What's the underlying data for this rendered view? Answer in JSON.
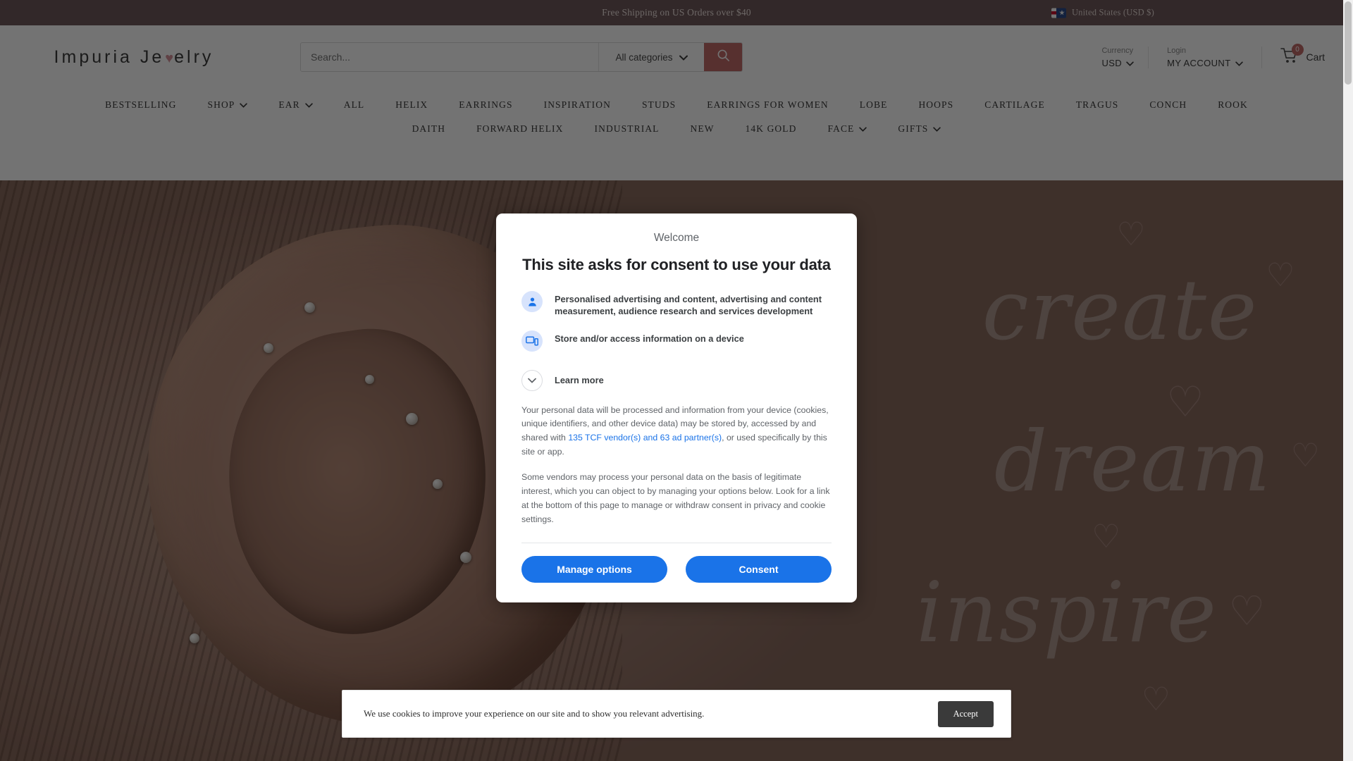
{
  "announcement": {
    "text": "Free Shipping on US Orders over $40",
    "language": "United States (USD $)",
    "flag_icon": "us-flag-icon"
  },
  "header": {
    "logo": {
      "part1": "Impuria Je",
      "heart": "♥",
      "part2": "elry"
    },
    "search": {
      "placeholder": "Search...",
      "value": "",
      "icon": "search-icon"
    },
    "categories": {
      "label": "All categories",
      "icon": "chevron-down-icon"
    },
    "currency": {
      "label": "Currency",
      "value": "USD",
      "icon": "chevron-down-icon"
    },
    "account": {
      "label": "Login",
      "value": "MY ACCOUNT",
      "icon": "chevron-down-icon"
    },
    "cart": {
      "label": "Cart",
      "count": "0",
      "icon": "cart-icon"
    }
  },
  "nav": {
    "row1": [
      {
        "label": "BESTSELLING",
        "caret": false
      },
      {
        "label": "SHOP",
        "caret": true
      },
      {
        "label": "EAR",
        "caret": true
      },
      {
        "label": "ALL",
        "caret": false
      },
      {
        "label": "HELIX",
        "caret": false
      },
      {
        "label": "EARRINGS",
        "caret": false
      },
      {
        "label": "INSPIRATION",
        "caret": false
      },
      {
        "label": "STUDS",
        "caret": false
      },
      {
        "label": "EARRINGS FOR WOMEN",
        "caret": false
      },
      {
        "label": "LOBE",
        "caret": false
      },
      {
        "label": "HOOPS",
        "caret": false
      },
      {
        "label": "CARTILAGE",
        "caret": false
      },
      {
        "label": "TRAGUS",
        "caret": false
      },
      {
        "label": "CONCH",
        "caret": false
      },
      {
        "label": "ROOK",
        "caret": false
      }
    ],
    "row2": [
      {
        "label": "DAITH",
        "caret": false
      },
      {
        "label": "FORWARD HELIX",
        "caret": false
      },
      {
        "label": "INDUSTRIAL",
        "caret": false
      },
      {
        "label": "NEW",
        "caret": false
      },
      {
        "label": "14K GOLD",
        "caret": false
      },
      {
        "label": "FACE",
        "caret": true
      },
      {
        "label": "GIFTS",
        "caret": true
      }
    ]
  },
  "hero": {
    "word1": "create",
    "word2": "dream",
    "word3": "inspire"
  },
  "consent_modal": {
    "welcome": "Welcome",
    "title": "This site asks for consent to use your data",
    "purposes": [
      {
        "icon": "person-icon",
        "text": "Personalised advertising and content, advertising and content measurement, audience research and services development"
      },
      {
        "icon": "devices-icon",
        "text": "Store and/or access information on a device"
      }
    ],
    "learn_more": {
      "label": "Learn more",
      "icon": "chevron-down-icon"
    },
    "body_1_pre": "Your personal data will be processed and information from your device (cookies, unique identifiers, and other device data) may be stored by, accessed by and shared with ",
    "body_1_link": "135 TCF vendor(s) and 63 ad partner(s)",
    "body_1_post": ", or used specifically by this site or app.",
    "body_2": "Some vendors may process your personal data on the basis of legitimate interest, which you can object to by managing your options below. Look for a link at the bottom of this page to manage or withdraw consent in privacy and cookie settings.",
    "manage_label": "Manage options",
    "consent_label": "Consent"
  },
  "cookie_bar": {
    "text": "We use cookies to improve your experience on our site and to show you relevant advertising.",
    "accept_label": "Accept"
  },
  "colors": {
    "announcement_bg": "#6f5a5c",
    "accent": "#c06a68",
    "consent_blue": "#1a73e8",
    "icon_bg": "#d7e3fc",
    "cookie_btn": "#3a3a3a"
  }
}
